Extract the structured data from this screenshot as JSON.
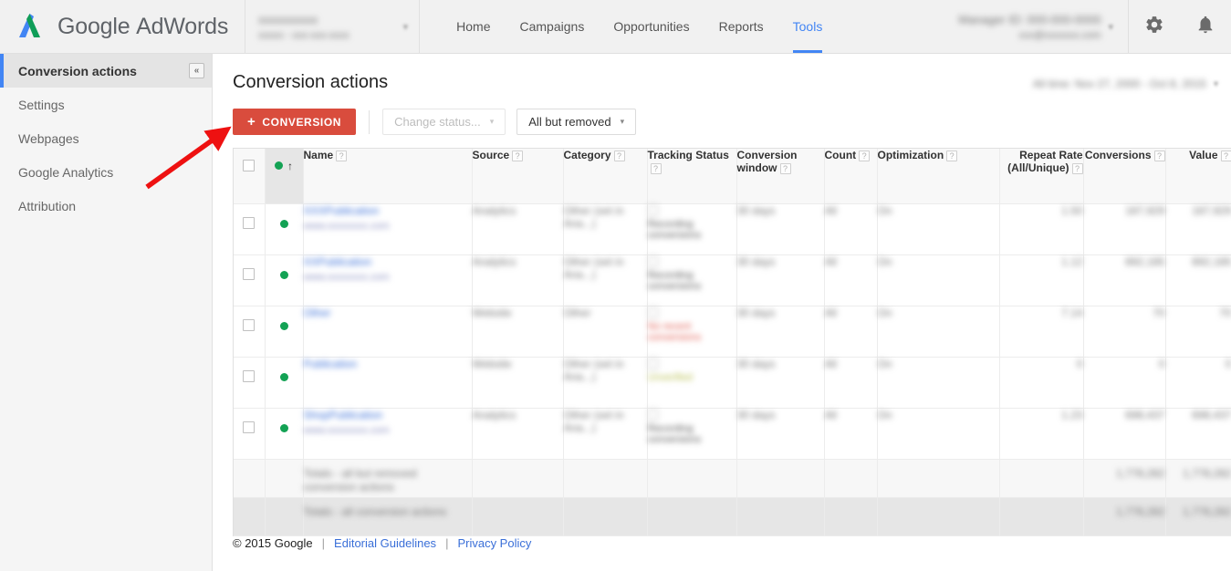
{
  "topbar": {
    "logo_text_google": "Google",
    "logo_text_product": "AdWords",
    "logo_icon": "adwords-logo-icon",
    "account_name": "xxxxxxxxxx",
    "account_sub": "xxxxx - xxx-xxx-xxxx",
    "account_caret": "▾",
    "nav": [
      {
        "label": "Home",
        "active": false
      },
      {
        "label": "Campaigns",
        "active": false
      },
      {
        "label": "Opportunities",
        "active": false
      },
      {
        "label": "Reports",
        "active": false
      },
      {
        "label": "Tools",
        "active": true
      }
    ],
    "mcc_line1": "Manager ID: 000-000-0000",
    "mcc_line2": "xxx@xxxxxxx.com",
    "mcc_caret": "▾",
    "gear_icon": "gear-icon",
    "bell_icon": "bell-icon"
  },
  "sidebar": {
    "items": [
      {
        "label": "Conversion actions",
        "selected": true
      },
      {
        "label": "Settings",
        "selected": false
      },
      {
        "label": "Webpages",
        "selected": false
      },
      {
        "label": "Google Analytics",
        "selected": false
      },
      {
        "label": "Attribution",
        "selected": false
      }
    ],
    "collapse_glyph": "«"
  },
  "main": {
    "page_title": "Conversion actions",
    "date_range": "All time: Nov 27, 2000 - Oct 8, 2015",
    "date_range_caret": "▾",
    "toolbar": {
      "conversion_button": "CONVERSION",
      "conversion_plus": "+",
      "change_status_label": "Change status...",
      "filter_label": "All but removed",
      "caret": "▾"
    }
  },
  "table": {
    "headers": [
      {
        "label": "",
        "help": false,
        "kind": "check"
      },
      {
        "label": "",
        "help": false,
        "kind": "status",
        "sorted": true,
        "sort_glyph": "↑"
      },
      {
        "label": "Name",
        "help": true,
        "kind": "text"
      },
      {
        "label": "Source",
        "help": true,
        "kind": "text"
      },
      {
        "label": "Category",
        "help": true,
        "kind": "text"
      },
      {
        "label": "Tracking Status",
        "help": true,
        "kind": "text"
      },
      {
        "label": "Conversion window",
        "help": true,
        "kind": "text"
      },
      {
        "label": "Count",
        "help": true,
        "kind": "text"
      },
      {
        "label": "Optimization",
        "help": true,
        "kind": "text"
      },
      {
        "label": "Repeat Rate (All/Unique)",
        "help": true,
        "kind": "num"
      },
      {
        "label": "Conversions",
        "help": true,
        "kind": "num"
      },
      {
        "label": "Value",
        "help": true,
        "kind": "num"
      }
    ],
    "rows": [
      {
        "status": "enabled",
        "name": "XXXPublication",
        "name_sub": "www.xxxxxxxx.com",
        "source": "Analytics",
        "category": "Other (set in Ana...)",
        "tracking": "Recording conversions",
        "tracking_color": "gray",
        "window": "30 days",
        "count": "All",
        "optimization": "On",
        "repeat_rate": "1.50",
        "conversions": "187,929",
        "value": "187,929"
      },
      {
        "status": "enabled",
        "name": "XXPublication",
        "name_sub": "www.xxxxxxxx.com",
        "source": "Analytics",
        "category": "Other (set in Ana...)",
        "tracking": "Recording conversions",
        "tracking_color": "gray",
        "window": "30 days",
        "count": "All",
        "optimization": "On",
        "repeat_rate": "1.12",
        "conversions": "892,185",
        "value": "892,185"
      },
      {
        "status": "enabled",
        "name": "Other",
        "name_sub": "",
        "source": "Website",
        "category": "Other",
        "tracking": "No recent conversions",
        "tracking_color": "red",
        "window": "30 days",
        "count": "All",
        "optimization": "On",
        "repeat_rate": "7.14",
        "conversions": "70",
        "value": "70"
      },
      {
        "status": "enabled",
        "name": "Publication",
        "name_sub": "",
        "source": "Website",
        "category": "Other (set in Ana...)",
        "tracking": "Unverified",
        "tracking_color": "yellow",
        "window": "30 days",
        "count": "All",
        "optimization": "On",
        "repeat_rate": "0",
        "conversions": "0",
        "value": "0"
      },
      {
        "status": "enabled",
        "name": "ShopPublication",
        "name_sub": "www.xxxxxxxx.com",
        "source": "Analytics",
        "category": "Other (set in Ana...)",
        "tracking": "Recording conversions",
        "tracking_color": "gray",
        "window": "30 days",
        "count": "All",
        "optimization": "On",
        "repeat_rate": "1.23",
        "conversions": "698,437",
        "value": "698,437"
      }
    ],
    "totals": [
      {
        "label": "Totals - all but removed conversion actions",
        "conversions": "1,778,282",
        "value": "1,778,282",
        "style": "light"
      },
      {
        "label": "Totals - all conversion actions",
        "conversions": "1,778,282",
        "value": "1,778,282",
        "style": "dark"
      }
    ]
  },
  "footer": {
    "copyright": "© 2015 Google",
    "sep1": "|",
    "link_editorial": "Editorial Guidelines",
    "sep2": "|",
    "link_privacy": "Privacy Policy"
  },
  "annotation": {
    "arrow_color": "#ee1111",
    "points_at": "conversion-button"
  }
}
